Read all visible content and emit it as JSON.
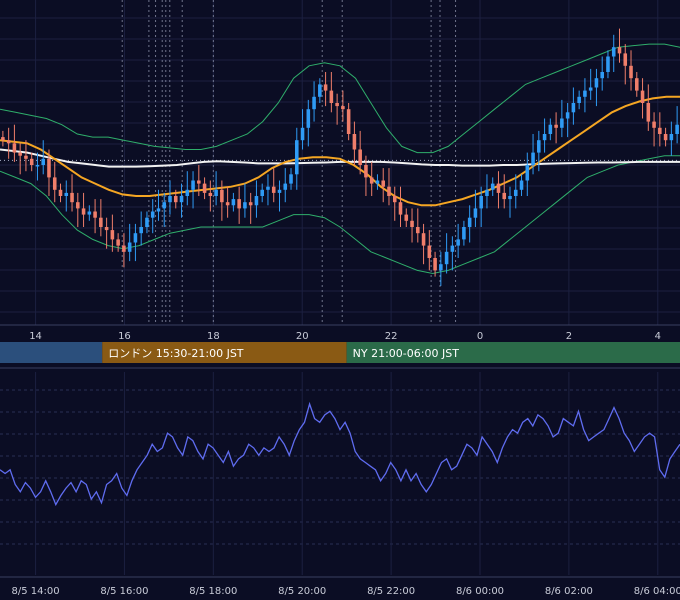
{
  "colors": {
    "background": "#0b0d24",
    "grid": "#1c2040",
    "up_candle": "#2f9bf5",
    "down_candle": "#ef7e6a",
    "ma_slow": "#f2f2f2",
    "ma_mid": "#f5a623",
    "bollinger": "#2fae6b",
    "indicator_line": "#5f6cf0",
    "axis_text": "#c9ccd8",
    "session_tokyo": "#2b4f7c",
    "session_london": "#8a5a14",
    "session_ny": "#2b6b49"
  },
  "sessions": [
    {
      "label": "",
      "color": "#2b4f7c",
      "start": 9.0,
      "end": 15.5
    },
    {
      "label": "ロンドン 15:30-21:00 JST",
      "color": "#8a5a14",
      "start": 15.5,
      "end": 21.0
    },
    {
      "label": "NY 21:00-06:00 JST",
      "color": "#2b6b49",
      "start": 21.0,
      "end": 30.0
    }
  ],
  "chart_data": [
    {
      "type": "candlestick",
      "title": "",
      "x_unit": "hours (JST)",
      "xlim": [
        13.2,
        28.5
      ],
      "ylim": [
        0,
        100
      ],
      "x_tick_labels": [
        "14",
        "16",
        "18",
        "20",
        "22",
        "0",
        "2",
        "4"
      ],
      "x_tick_values": [
        14,
        16,
        18,
        20,
        22,
        24,
        26,
        28
      ],
      "legend": "none",
      "grid": true,
      "event_lines_x": [
        15.95,
        16.55,
        16.7,
        16.85,
        16.93,
        17.02,
        17.3,
        18.0,
        20.45,
        20.9,
        22.9,
        23.1,
        23.45
      ],
      "reference_level": 51.5,
      "series": [
        {
          "name": "",
          "kind": "price_close",
          "values": [
            58,
            57,
            54,
            53,
            52,
            50,
            50,
            52,
            46,
            42,
            40,
            41,
            38,
            36,
            34,
            35,
            33,
            30,
            29,
            26,
            24,
            22,
            25,
            28,
            30,
            33,
            35,
            36,
            38,
            40,
            38,
            40,
            42,
            45,
            44,
            41,
            40,
            42,
            38,
            37,
            39,
            36,
            38,
            37,
            40,
            42,
            43,
            41,
            42,
            44,
            47,
            58,
            62,
            68,
            72,
            76,
            74,
            70,
            69,
            68,
            60,
            55,
            50,
            46,
            44,
            45,
            43,
            40,
            38,
            34,
            32,
            30,
            28,
            24,
            20,
            16,
            18,
            22,
            24,
            26,
            30,
            33,
            36,
            40,
            42,
            44,
            41,
            39,
            40,
            42,
            45,
            50,
            54,
            58,
            60,
            63,
            62,
            65,
            67,
            70,
            72,
            74,
            75,
            78,
            80,
            85,
            88,
            86,
            82,
            78,
            74,
            70,
            64,
            62,
            60,
            58,
            60,
            63
          ]
        },
        {
          "name": "",
          "kind": "ma_slow",
          "values": [
            55,
            54.5,
            54,
            53,
            52,
            51,
            50.5,
            50,
            49.5,
            49.5,
            49.5,
            49.6,
            49.8,
            50,
            50.5,
            51,
            51.2,
            51,
            50.8,
            50.5,
            50.5,
            50.5,
            50.6,
            50.7,
            50.8,
            51,
            51,
            51,
            51,
            50.8,
            50.5,
            50.2,
            50,
            50,
            49.8,
            49.8,
            49.8,
            50,
            50,
            50.2,
            50.4,
            50.5,
            50.6,
            50.7,
            50.8,
            50.8,
            50.9,
            51,
            51,
            51,
            51
          ]
        },
        {
          "name": "",
          "kind": "ma_mid",
          "values": [
            58,
            57.5,
            57,
            55,
            52,
            49,
            46,
            44,
            42,
            40.5,
            40,
            40,
            40.5,
            41,
            41.5,
            42,
            42.5,
            43,
            44,
            46,
            49,
            51,
            52,
            52.5,
            52.5,
            52,
            50,
            47,
            43,
            40,
            38,
            37,
            37,
            38,
            39,
            40.5,
            42,
            44,
            46,
            49,
            52,
            55,
            58,
            61,
            64,
            67,
            69,
            70.5,
            71.5,
            72,
            72
          ]
        },
        {
          "name": "",
          "kind": "bollinger_upper",
          "values": [
            68,
            67,
            66,
            65,
            63,
            60,
            59,
            59,
            58,
            57,
            56,
            55.5,
            55,
            55,
            56,
            58,
            60,
            64,
            70,
            78,
            82,
            83,
            82,
            78,
            70,
            62,
            56,
            54,
            54,
            56,
            60,
            64,
            68,
            72,
            76,
            78,
            80,
            82,
            84,
            86,
            88,
            88.5,
            89,
            89,
            88
          ]
        },
        {
          "name": "",
          "kind": "bollinger_lower",
          "values": [
            48,
            46,
            44,
            40,
            34,
            29,
            26,
            24,
            23,
            24,
            26,
            28,
            29,
            30,
            30,
            30,
            30,
            30,
            32,
            34,
            34,
            33,
            30,
            26,
            22,
            20,
            18,
            16,
            15,
            16,
            18,
            20,
            22,
            26,
            30,
            34,
            38,
            42,
            46,
            48,
            50,
            51,
            52,
            53,
            53
          ]
        }
      ]
    },
    {
      "type": "line",
      "title": "",
      "x_unit": "hours (JST)",
      "xlim": [
        13.2,
        28.5
      ],
      "ylim": [
        0,
        100
      ],
      "x_tick_labels": [
        "8/5 14:00",
        "8/5 16:00",
        "8/5 18:00",
        "8/5 20:00",
        "8/5 22:00",
        "8/6 00:00",
        "8/6 02:00",
        "8/6 04:00"
      ],
      "x_tick_values": [
        14,
        16,
        18,
        20,
        22,
        24,
        26,
        28
      ],
      "legend": "none",
      "grid": true,
      "series": [
        {
          "name": "",
          "values": [
            52,
            50,
            52,
            44,
            40,
            45,
            42,
            37,
            40,
            46,
            40,
            33,
            38,
            42,
            45,
            40,
            46,
            44,
            36,
            40,
            34,
            44,
            46,
            50,
            42,
            38,
            46,
            52,
            56,
            60,
            66,
            62,
            64,
            72,
            70,
            64,
            60,
            70,
            68,
            62,
            58,
            66,
            64,
            60,
            56,
            62,
            54,
            58,
            60,
            66,
            64,
            60,
            64,
            62,
            64,
            70,
            66,
            60,
            68,
            74,
            78,
            88,
            80,
            78,
            82,
            84,
            80,
            74,
            78,
            72,
            62,
            58,
            56,
            54,
            52,
            46,
            50,
            56,
            52,
            46,
            52,
            46,
            50,
            44,
            40,
            44,
            50,
            56,
            58,
            52,
            54,
            60,
            66,
            64,
            60,
            70,
            66,
            62,
            56,
            64,
            70,
            74,
            72,
            78,
            80,
            76,
            82,
            80,
            76,
            70,
            72,
            80,
            78,
            76,
            84,
            74,
            68,
            70,
            72,
            74,
            80,
            86,
            80,
            72,
            68,
            62,
            66,
            70,
            72,
            70,
            52,
            48,
            58,
            62,
            66
          ]
        }
      ]
    }
  ]
}
